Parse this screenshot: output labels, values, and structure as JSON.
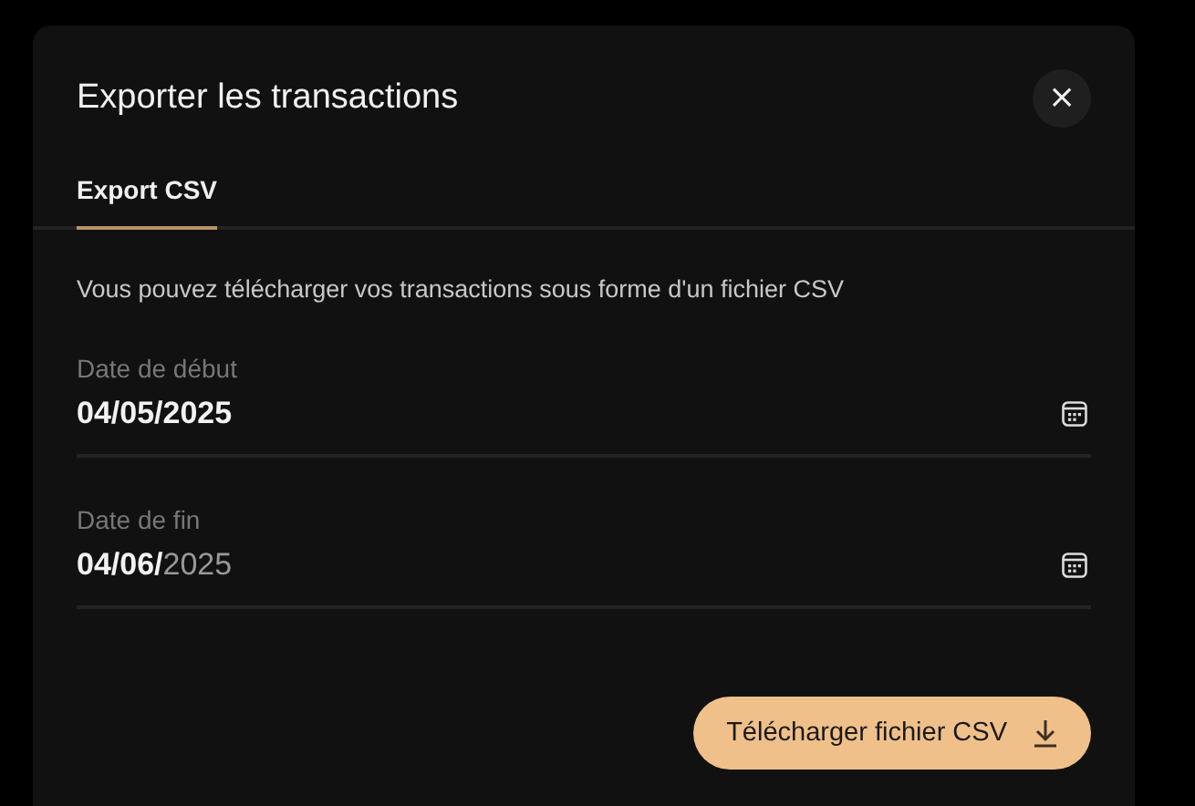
{
  "dialog": {
    "title": "Exporter les transactions",
    "close_label": "×"
  },
  "tabs": [
    {
      "label": "Export CSV",
      "selected": true
    }
  ],
  "description": "Vous pouvez télécharger vos transactions sous forme d'un fichier CSV",
  "fields": [
    {
      "label": "Date de début",
      "value": [
        {
          "text": "04/05/2025",
          "dimmed": false
        }
      ]
    },
    {
      "label": "Date de fin",
      "value": [
        {
          "text": "04/06/",
          "dimmed": false
        },
        {
          "text": "2025",
          "dimmed": true
        }
      ]
    }
  ],
  "download_button": {
    "label": "Télécharger fichier CSV"
  }
}
